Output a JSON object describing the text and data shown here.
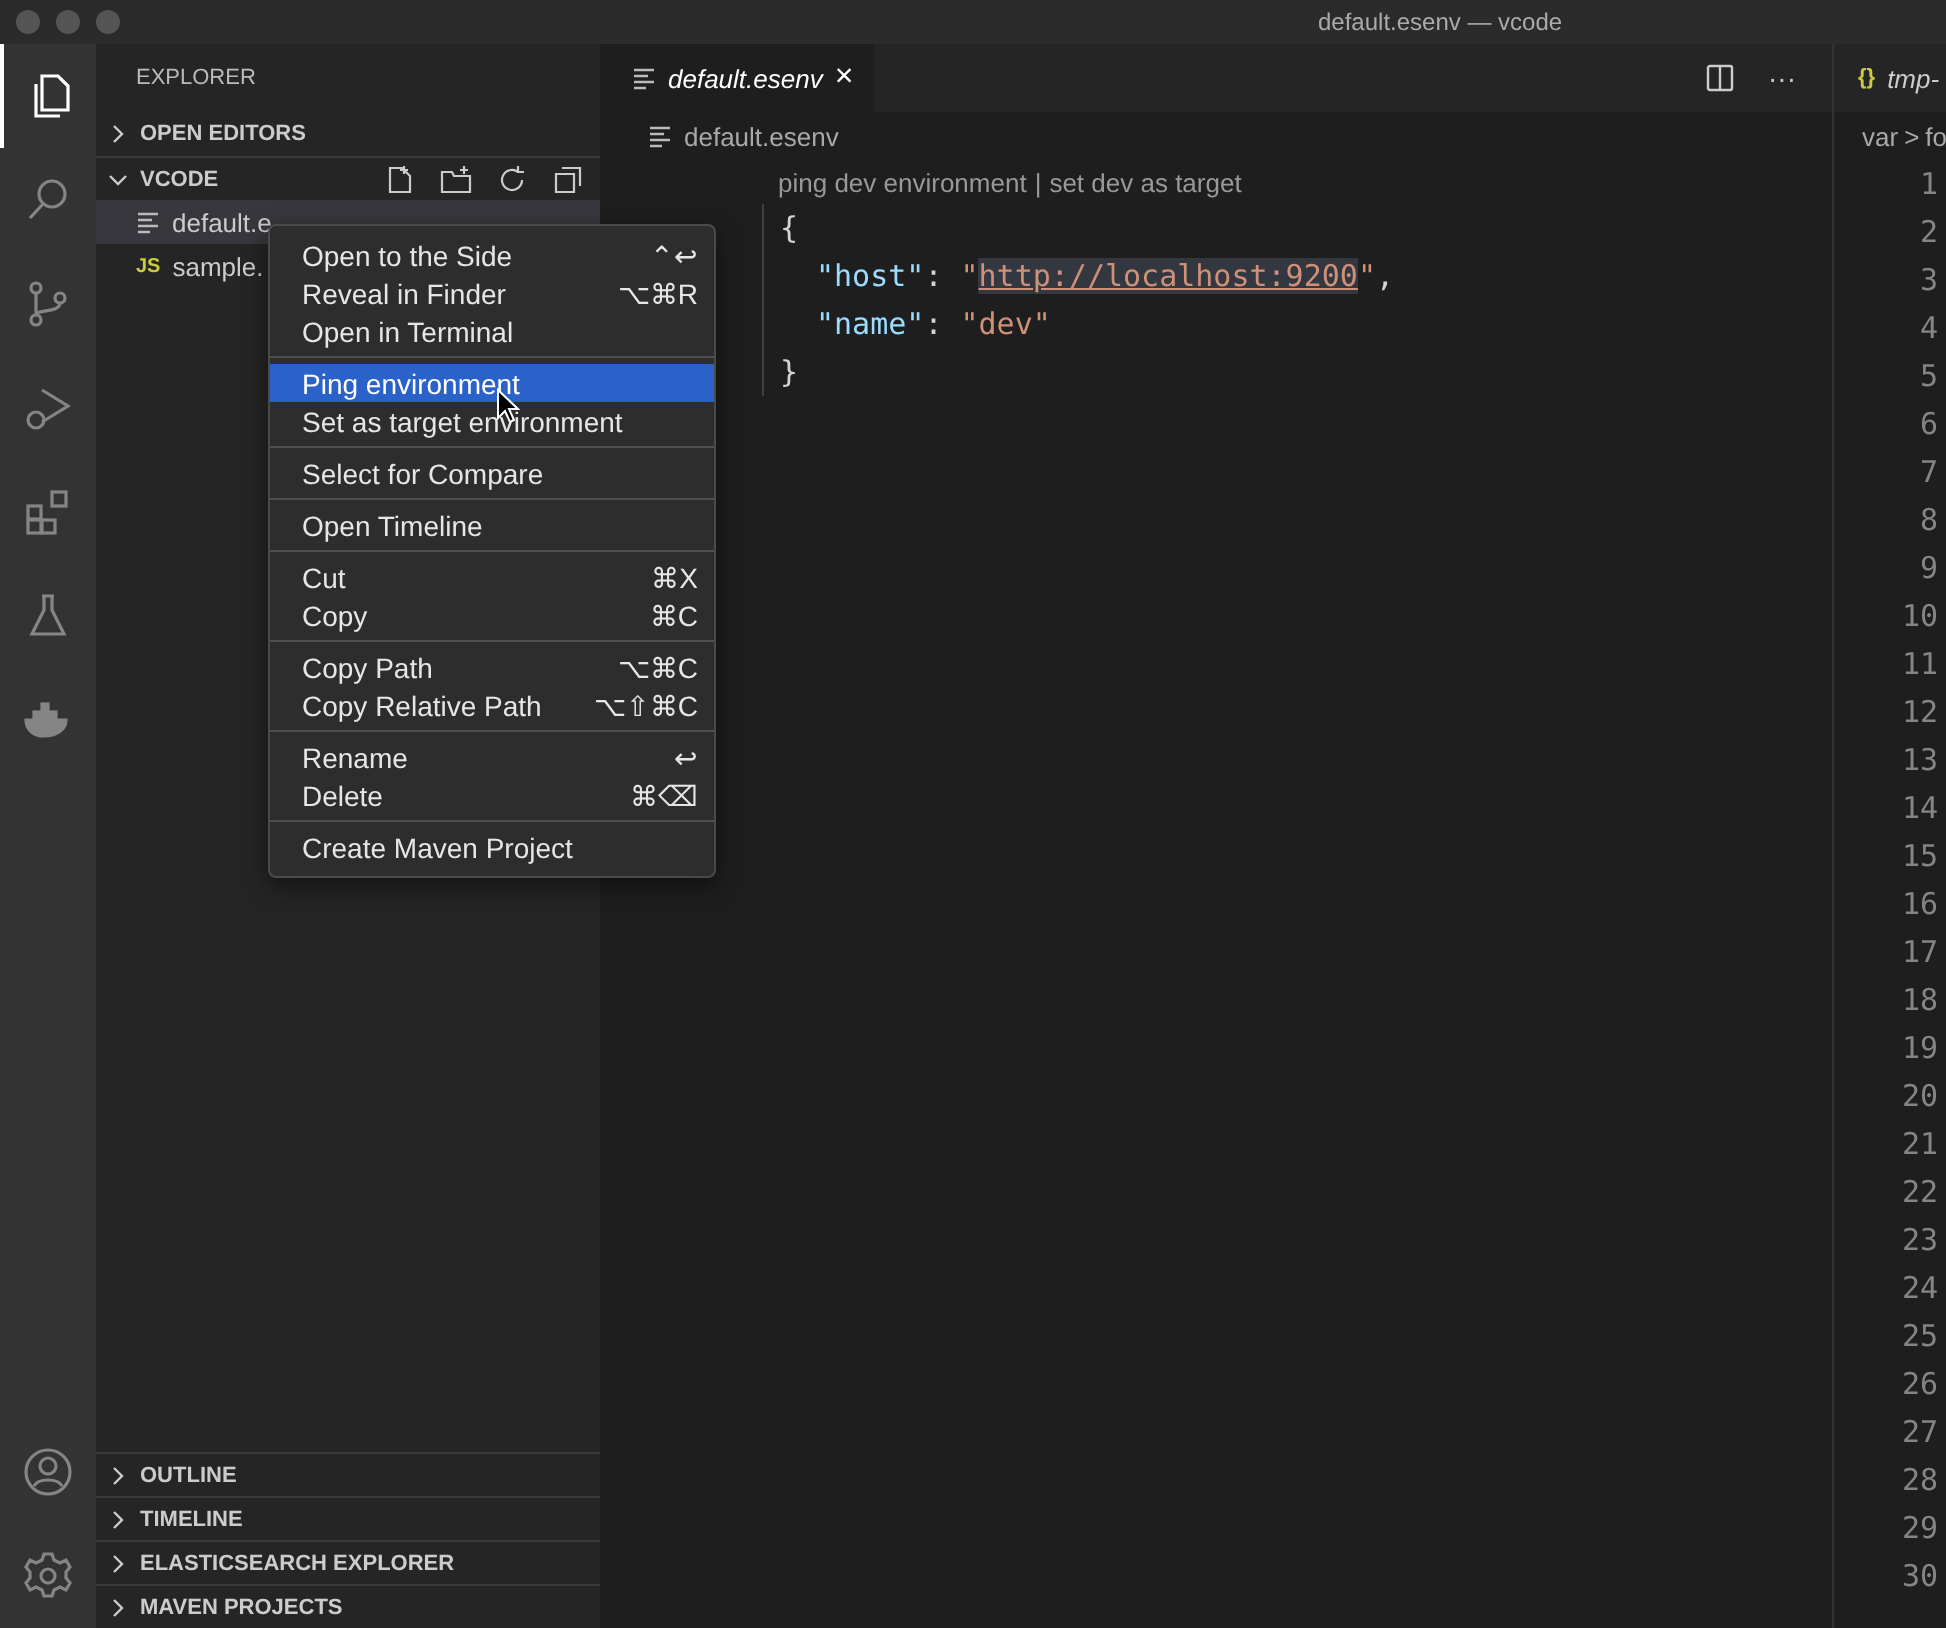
{
  "window": {
    "title": "default.esenv — vcode"
  },
  "activity_bar": {
    "items": [
      {
        "selected": true
      },
      {
        "selected": false
      },
      {
        "selected": false
      },
      {
        "selected": false
      },
      {
        "selected": false
      },
      {
        "selected": false
      },
      {
        "selected": false
      }
    ],
    "bottom": [
      {
        "selected": false
      },
      {
        "selected": false
      }
    ]
  },
  "sidebar": {
    "title": "EXPLORER",
    "sections": [
      {
        "label": "OPEN EDITORS",
        "expanded": false
      },
      {
        "label": "VCODE",
        "expanded": true,
        "files": [
          {
            "name": "default.e",
            "selected": true,
            "kind": "text"
          },
          {
            "name": "sample.",
            "selected": false,
            "kind": "js",
            "icon_text": "JS"
          }
        ]
      }
    ],
    "bottom_sections": [
      {
        "label": "OUTLINE",
        "expanded": false
      },
      {
        "label": "TIMELINE",
        "expanded": false
      },
      {
        "label": "ELASTICSEARCH EXPLORER",
        "expanded": false
      },
      {
        "label": "MAVEN PROJECTS",
        "expanded": false
      }
    ]
  },
  "editor": {
    "tabs": [
      {
        "label": "default.esenv",
        "selected": true,
        "close": "×"
      }
    ],
    "actions": [
      "···"
    ],
    "breadcrumb": "default.esenv",
    "codelens": [
      "ping dev environment",
      "set dev as target"
    ],
    "codelens_separator": "|",
    "lines": [
      {
        "indented": false,
        "tokens": [
          {
            "kind": "punct",
            "text": "{"
          }
        ]
      },
      {
        "indented": true,
        "tokens": [
          {
            "kind": "key",
            "text": "\"host\""
          },
          {
            "kind": "punct",
            "text": ": "
          },
          {
            "kind": "string",
            "text": "\""
          },
          {
            "kind": "link",
            "text": "http://localhost:9200"
          },
          {
            "kind": "string",
            "text": "\""
          },
          {
            "kind": "punct",
            "text": ","
          }
        ]
      },
      {
        "indented": true,
        "tokens": [
          {
            "kind": "key",
            "text": "\"name\""
          },
          {
            "kind": "punct",
            "text": ": "
          },
          {
            "kind": "string",
            "text": "\"dev\""
          }
        ]
      },
      {
        "indented": false,
        "tokens": [
          {
            "kind": "punct",
            "text": "}"
          }
        ]
      }
    ]
  },
  "context_menu": {
    "groups": [
      [
        {
          "label": "Open to the Side",
          "shortcut": "⌃↩",
          "selected": false
        },
        {
          "label": "Reveal in Finder",
          "shortcut": "⌥⌘R",
          "selected": false
        },
        {
          "label": "Open in Terminal",
          "selected": false
        }
      ],
      [
        {
          "label": "Ping environment",
          "selected": true
        },
        {
          "label": "Set as target environment",
          "selected": false
        }
      ],
      [
        {
          "label": "Select for Compare",
          "selected": false
        }
      ],
      [
        {
          "label": "Open Timeline",
          "selected": false
        }
      ],
      [
        {
          "label": "Cut",
          "shortcut": "⌘X",
          "selected": false
        },
        {
          "label": "Copy",
          "shortcut": "⌘C",
          "selected": false
        }
      ],
      [
        {
          "label": "Copy Path",
          "shortcut": "⌥⌘C",
          "selected": false
        },
        {
          "label": "Copy Relative Path",
          "shortcut": "⌥⇧⌘C",
          "selected": false
        }
      ],
      [
        {
          "label": "Rename",
          "shortcut": "↩",
          "selected": false
        },
        {
          "label": "Delete",
          "shortcut": "⌘⌫",
          "selected": false
        }
      ],
      [
        {
          "label": "Create Maven Project",
          "selected": false
        }
      ]
    ]
  },
  "right_pane": {
    "tab": {
      "icon_text": "{}",
      "label": "tmp-"
    },
    "breadcrumb": [
      "var",
      "fo"
    ],
    "breadcrumb_separator": ">",
    "line_numbers": [
      "1",
      "2",
      "3",
      "4",
      "5",
      "6",
      "7",
      "8",
      "9",
      "10",
      "11",
      "12",
      "13",
      "14",
      "15",
      "16",
      "17",
      "18",
      "19",
      "20",
      "21",
      "22",
      "23",
      "24",
      "25",
      "26",
      "27",
      "28",
      "29",
      "30"
    ]
  }
}
